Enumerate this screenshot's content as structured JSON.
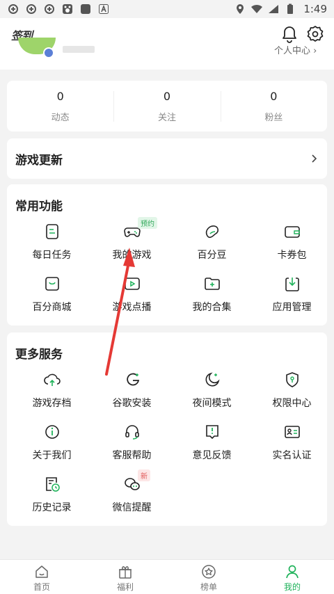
{
  "status_bar": {
    "time": "1:49"
  },
  "header": {
    "signin_label": "签到",
    "personal_center": "个人中心 ›"
  },
  "stats": [
    {
      "value": "0",
      "label": "动态"
    },
    {
      "value": "0",
      "label": "关注"
    },
    {
      "value": "0",
      "label": "粉丝"
    }
  ],
  "game_update": {
    "title": "游戏更新"
  },
  "common": {
    "title": "常用功能",
    "items": [
      {
        "label": "每日任务",
        "icon": "daily-task-icon"
      },
      {
        "label": "我的游戏",
        "icon": "gamepad-icon",
        "tag": "预约"
      },
      {
        "label": "百分豆",
        "icon": "bean-icon"
      },
      {
        "label": "卡券包",
        "icon": "wallet-icon"
      },
      {
        "label": "百分商城",
        "icon": "store-icon"
      },
      {
        "label": "游戏点播",
        "icon": "video-play-icon"
      },
      {
        "label": "我的合集",
        "icon": "folder-plus-icon"
      },
      {
        "label": "应用管理",
        "icon": "download-manage-icon"
      }
    ]
  },
  "more": {
    "title": "更多服务",
    "items": [
      {
        "label": "游戏存档",
        "icon": "cloud-upload-icon"
      },
      {
        "label": "谷歌安装",
        "icon": "google-icon"
      },
      {
        "label": "夜间模式",
        "icon": "moon-icon"
      },
      {
        "label": "权限中心",
        "icon": "shield-icon"
      },
      {
        "label": "关于我们",
        "icon": "info-icon"
      },
      {
        "label": "客服帮助",
        "icon": "headset-icon"
      },
      {
        "label": "意见反馈",
        "icon": "feedback-icon"
      },
      {
        "label": "实名认证",
        "icon": "id-card-icon"
      },
      {
        "label": "历史记录",
        "icon": "history-icon"
      },
      {
        "label": "微信提醒",
        "icon": "wechat-icon",
        "tag": "新"
      }
    ]
  },
  "tabbar": [
    {
      "label": "首页",
      "icon": "home-icon"
    },
    {
      "label": "福利",
      "icon": "gift-icon"
    },
    {
      "label": "榜单",
      "icon": "star-badge-icon"
    },
    {
      "label": "我的",
      "icon": "user-icon",
      "active": true
    }
  ],
  "colors": {
    "accent": "#1fb25a",
    "annotation_arrow": "#e53935"
  }
}
